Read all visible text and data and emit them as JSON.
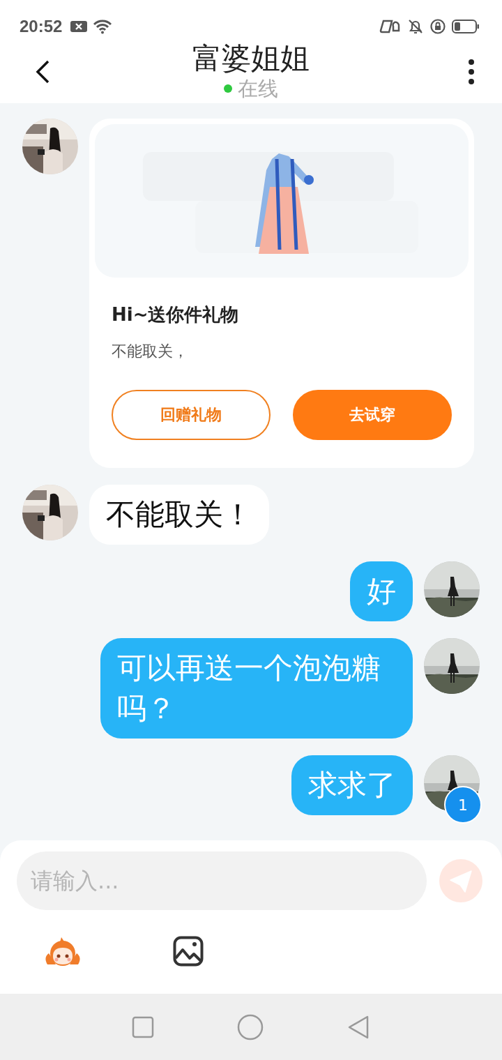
{
  "status_bar": {
    "time": "20:52"
  },
  "header": {
    "title": "富婆姐姐",
    "online": true,
    "status": "在线"
  },
  "messages": [
    {
      "kind": "gift",
      "outgoing": false,
      "title": "Hi~送你件礼物",
      "text": "不能取关，",
      "buttons": [
        {
          "label": "回赠礼物",
          "primary": false
        },
        {
          "label": "去试穿",
          "primary": true
        }
      ]
    },
    {
      "kind": "text",
      "outgoing": false,
      "text": "不能取关！"
    },
    {
      "kind": "text",
      "outgoing": true,
      "text": "好"
    },
    {
      "kind": "text",
      "outgoing": true,
      "text": "可以再送一个泡泡糖吗？"
    },
    {
      "kind": "text",
      "outgoing": true,
      "text": "求求了",
      "badge": "1"
    }
  ],
  "composer": {
    "placeholder": "请输入...",
    "send_disabled": true
  }
}
